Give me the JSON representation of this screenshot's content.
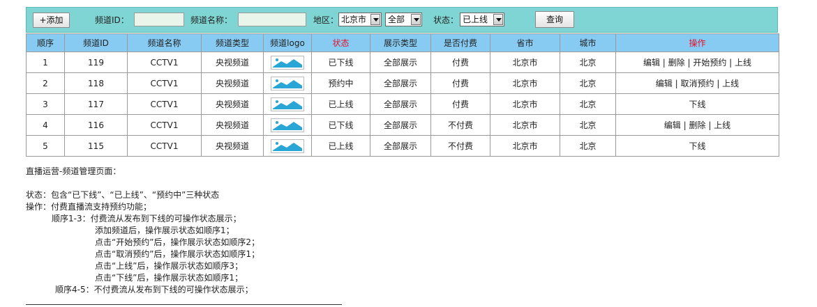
{
  "toolbar": {
    "add_label": "+添加",
    "channel_id_label": "频道ID：",
    "channel_id_value": "",
    "channel_name_label": "频道名称：",
    "channel_name_value": "",
    "region_label": "地区：",
    "region_province": "北京市",
    "region_city": "全部",
    "status_label": "状态：",
    "status_value": "已上线",
    "query_label": "查询"
  },
  "table": {
    "headers": [
      "顺序",
      "频道ID",
      "频道名称",
      "频道类型",
      "频道logo",
      "状态",
      "展示类型",
      "是否付费",
      "省市",
      "城市",
      "操作"
    ],
    "rows": [
      {
        "order": "1",
        "id": "119",
        "name": "CCTV1",
        "type": "央视频道",
        "status": "已下线",
        "display": "全部展示",
        "paid": "付费",
        "province": "北京市",
        "city": "北京",
        "ops": [
          "编辑",
          "删除",
          "开始预约",
          "上线"
        ]
      },
      {
        "order": "2",
        "id": "118",
        "name": "CCTV1",
        "type": "央视频道",
        "status": "预约中",
        "display": "全部展示",
        "paid": "付费",
        "province": "北京市",
        "city": "北京",
        "ops": [
          "编辑",
          "取消预约",
          "上线"
        ]
      },
      {
        "order": "3",
        "id": "117",
        "name": "CCTV1",
        "type": "央视频道",
        "status": "已上线",
        "display": "全部展示",
        "paid": "付费",
        "province": "北京市",
        "city": "北京",
        "ops": [
          "下线"
        ]
      },
      {
        "order": "4",
        "id": "116",
        "name": "CCTV1",
        "type": "央视频道",
        "status": "已下线",
        "display": "全部展示",
        "paid": "不付费",
        "province": "北京市",
        "city": "北京",
        "ops": [
          "编辑",
          "删除",
          "上线"
        ]
      },
      {
        "order": "5",
        "id": "115",
        "name": "CCTV1",
        "type": "央视频道",
        "status": "已上线",
        "display": "全部展示",
        "paid": "不付费",
        "province": "北京市",
        "city": "北京",
        "ops": [
          "下线"
        ]
      }
    ]
  },
  "notes": {
    "title": "直播运营-频道管理页面：",
    "lines": [
      "状态：包含“已下线”、“已上线”、“预约中”三种状态",
      "操作：付费直播流支持预约功能；",
      "顺序1-3：付费流从发布到下线的可操作状态展示；",
      "添加频道后，操作展示状态如顺序1；",
      "点击“开始预约”后，操作展示状态如顺序2；",
      "点击“取消预约”后，操作展示状态如顺序1；",
      "点击“上线”后，操作展示状态如顺序3；",
      "点击“下线”后，操作展示状态如顺序1；",
      "顺序4-5：不付费流从发布到下线的可操作状态展示；"
    ]
  }
}
